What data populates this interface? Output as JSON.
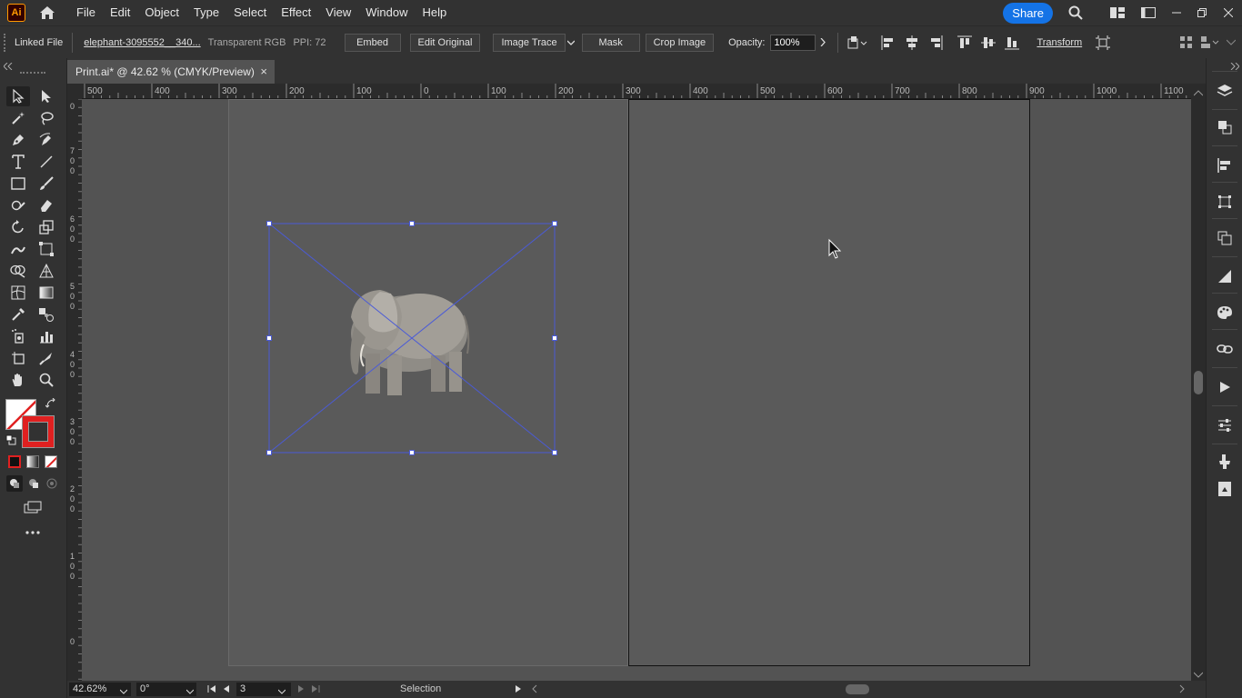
{
  "app": {
    "logo_text": "Ai",
    "menu": [
      "File",
      "Edit",
      "Object",
      "Type",
      "Select",
      "Effect",
      "View",
      "Window",
      "Help"
    ],
    "share_label": "Share"
  },
  "control_bar": {
    "linked_file_label": "Linked File",
    "file_name": "elephant-3095552__340...",
    "color_mode": "Transparent RGB",
    "ppi": "PPI: 72",
    "embed_label": "Embed",
    "edit_original_label": "Edit Original",
    "image_trace_label": "Image Trace",
    "mask_label": "Mask",
    "crop_image_label": "Crop Image",
    "opacity_label": "Opacity:",
    "opacity_value": "100%",
    "transform_label": "Transform"
  },
  "document": {
    "tab_title": "Print.ai* @ 42.62 % (CMYK/Preview)",
    "close_glyph": "×"
  },
  "ruler": {
    "top_labels": [
      "500",
      "400",
      "300",
      "200",
      "100",
      "0",
      "100",
      "200",
      "300",
      "400",
      "500",
      "600",
      "700",
      "800",
      "900",
      "1000",
      "1100"
    ],
    "left_labels": [
      "0",
      "7 0 0",
      "6 0 0",
      "5 0 0",
      "4 0 0",
      "3 0 0",
      "2 0 0",
      "1 0 0",
      "0"
    ]
  },
  "status_bar": {
    "zoom": "42.62%",
    "rotation": "0°",
    "artboard_number": "3",
    "mode": "Selection"
  },
  "colors": {
    "accent": "#1473e6",
    "selection": "#4b5bd6",
    "stroke_red": "#e02020"
  }
}
